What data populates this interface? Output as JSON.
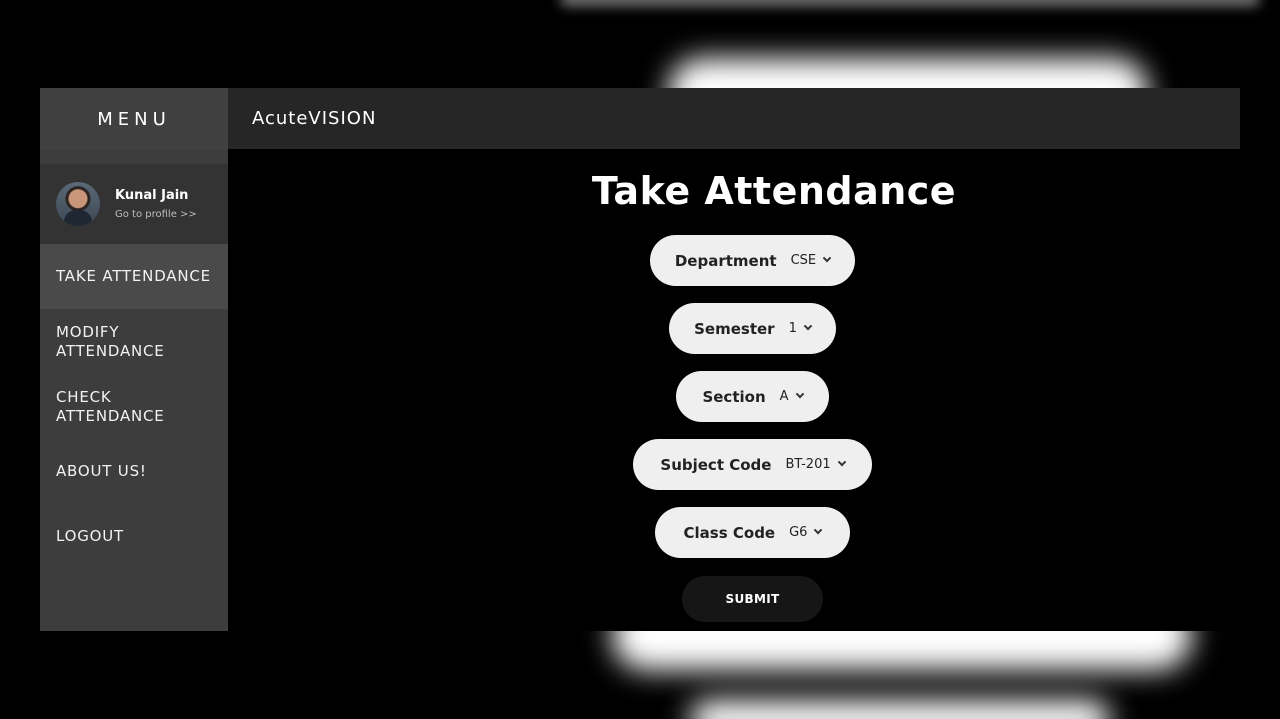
{
  "sidebar": {
    "menu_title": "MENU",
    "profile": {
      "name": "Kunal Jain",
      "link": "Go to profile >>"
    },
    "items": [
      {
        "label": "TAKE ATTENDANCE",
        "active": true
      },
      {
        "label": "MODIFY ATTENDANCE",
        "active": false
      },
      {
        "label": "CHECK ATTENDANCE",
        "active": false
      },
      {
        "label": "ABOUT US!",
        "active": false
      },
      {
        "label": "LOGOUT",
        "active": false
      }
    ]
  },
  "header": {
    "brand": "AcuteVISION"
  },
  "main": {
    "title": "Take Attendance",
    "fields": [
      {
        "label": "Department",
        "value": "CSE"
      },
      {
        "label": "Semester",
        "value": "1"
      },
      {
        "label": "Section",
        "value": "A"
      },
      {
        "label": "Subject Code",
        "value": "BT-201"
      },
      {
        "label": "Class Code",
        "value": "G6"
      }
    ],
    "submit_label": "SUBMIT"
  },
  "colors": {
    "sidebar_bg": "#3d3d3d",
    "topbar_bg": "#262626",
    "pill_bg": "#efefef",
    "submit_bg": "#161616"
  }
}
